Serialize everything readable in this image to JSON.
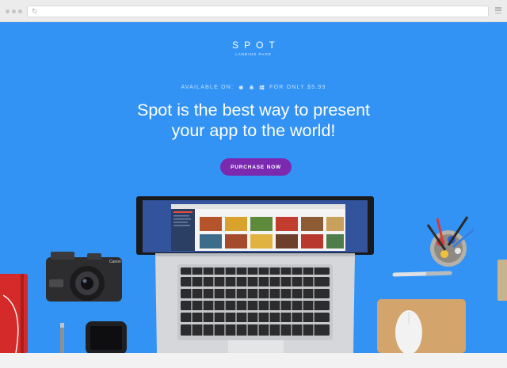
{
  "browser": {
    "url": "",
    "reload_icon": "reload-icon",
    "menu_icon": "hamburger-menu-icon"
  },
  "brand": {
    "name": "SPOT",
    "tagline": "LANDING PAGE"
  },
  "availability": {
    "label": "AVAILABLE ON:",
    "platform_icons": [
      "apple-icon",
      "android-icon",
      "windows-icon"
    ],
    "price_text": "FOR ONLY $5.99"
  },
  "headline": {
    "line1": "Spot is the best way to present",
    "line2": "your app to the world!"
  },
  "cta": {
    "label": "PURCHASE NOW"
  },
  "colors": {
    "hero_background": "#3293f5",
    "cta_background": "#7b2ab0",
    "chrome_background": "#ececec"
  },
  "scene": {
    "camera_brand": "Canon",
    "camera_model": "G12"
  }
}
